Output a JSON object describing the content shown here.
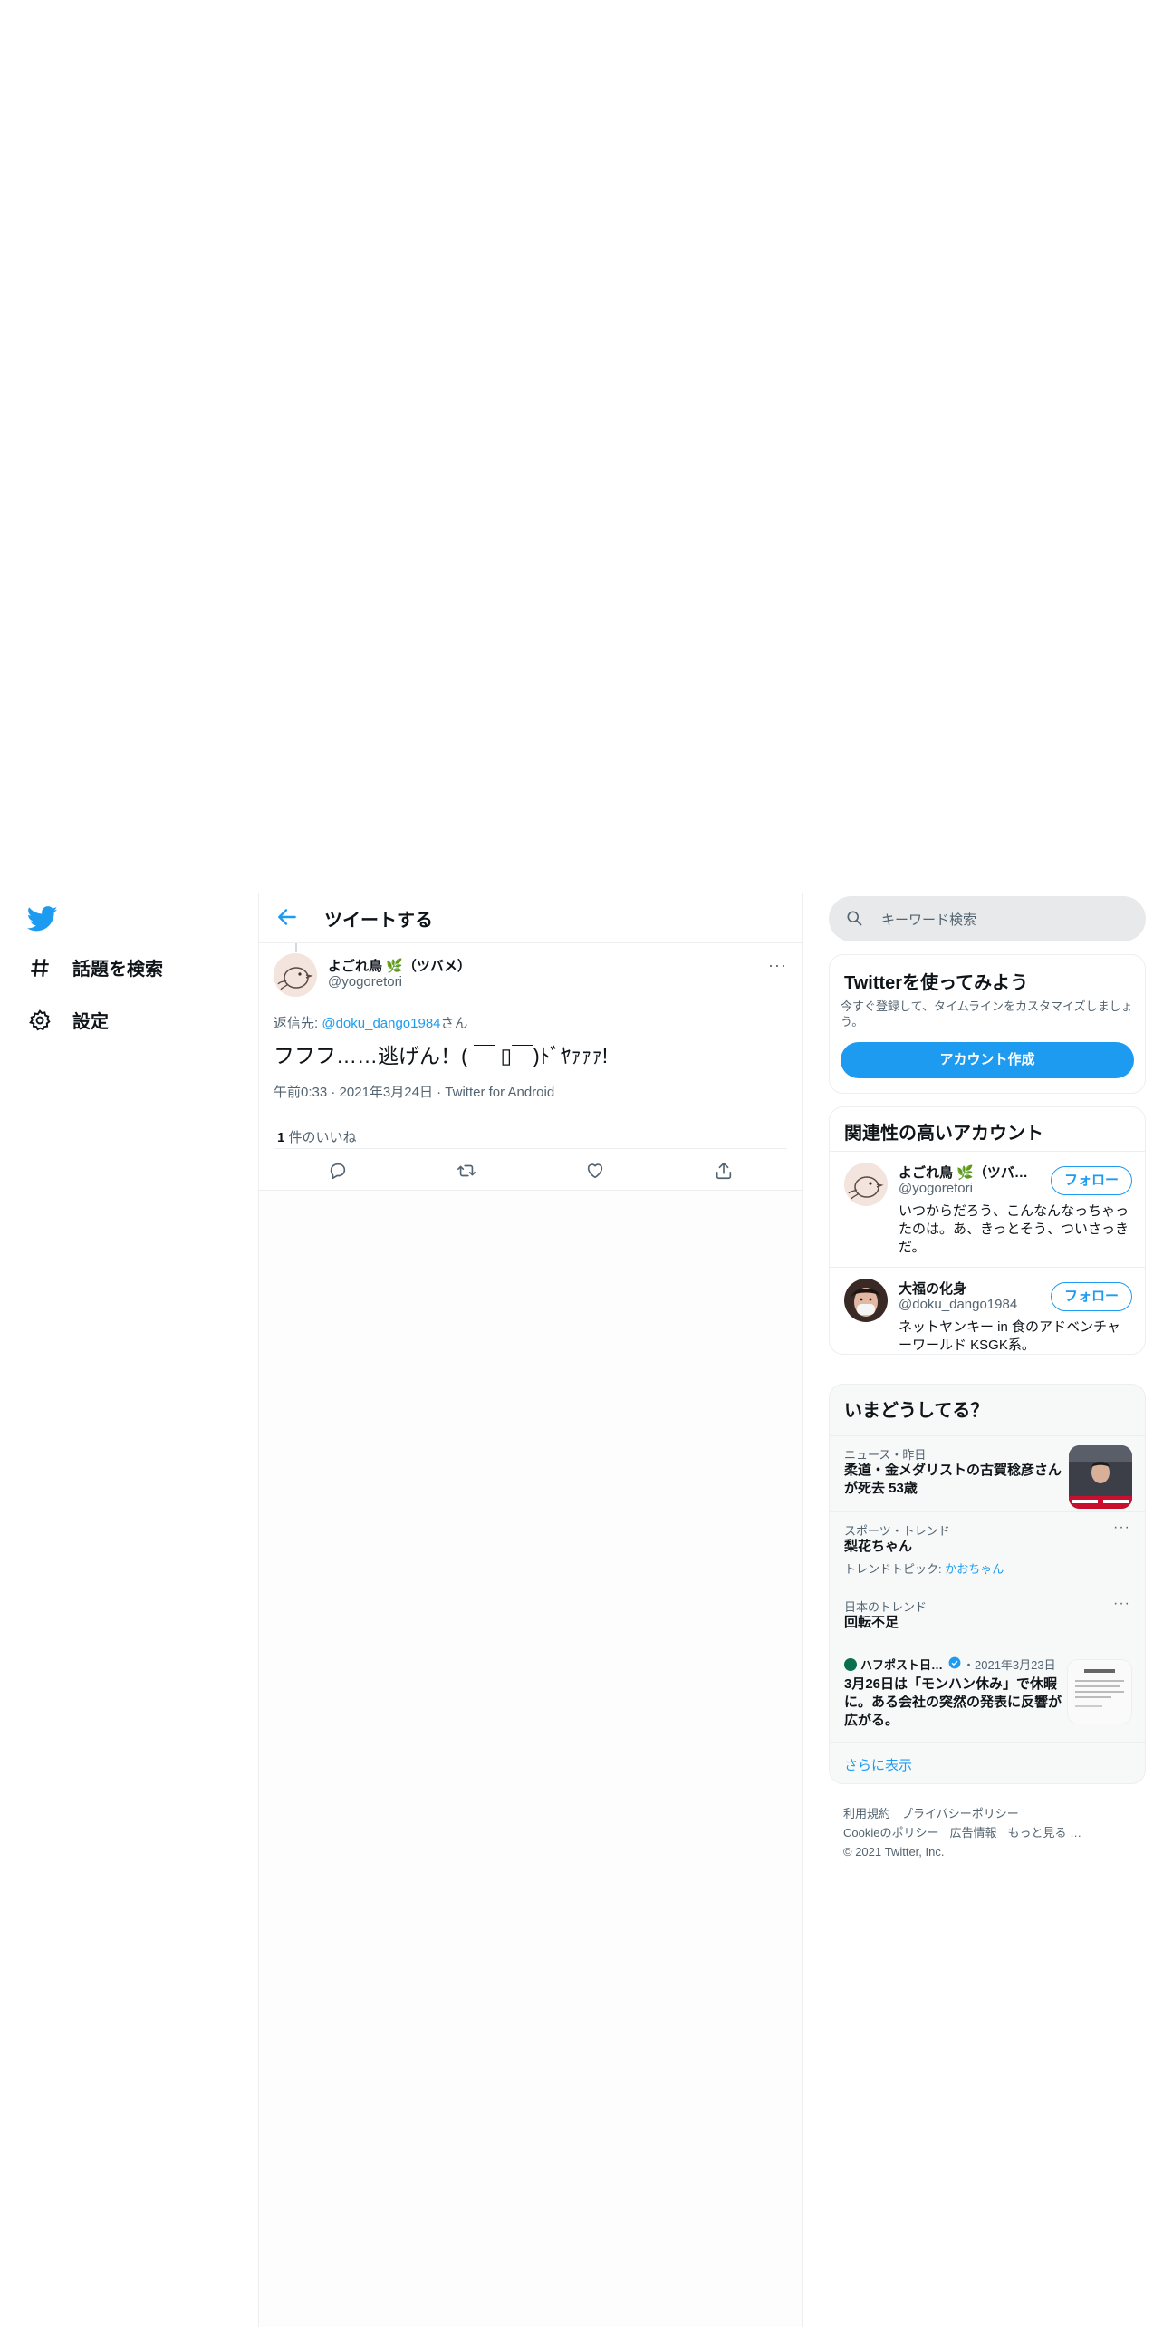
{
  "nav": {
    "explore_label": "話題を検索",
    "settings_label": "設定"
  },
  "header": {
    "title": "ツイートする"
  },
  "tweet": {
    "author_name": "よごれ鳥 🌿（ツバメ）",
    "author_handle": "@yogoretori",
    "reply_prefix": "返信先: ",
    "reply_target": "@doku_dango1984",
    "reply_suffix": "さん",
    "text": "フフフ……逃げん！( ￣ ▯￣)ﾄﾞﾔｧｧｧ!",
    "time": "午前0:33",
    "date": "2021年3月24日",
    "source": "Twitter for Android",
    "like_count": "1",
    "like_label": " 件のいいね"
  },
  "search": {
    "placeholder": "キーワード検索"
  },
  "signup": {
    "title": "Twitterを使ってみよう",
    "subtitle": "今すぐ登録して、タイムラインをカスタマイズしましょう。",
    "button": "アカウント作成"
  },
  "relevant": {
    "title": "関連性の高いアカウント",
    "accounts": [
      {
        "name": "よごれ鳥 🌿（ツバメ）",
        "handle": "@yogoretori",
        "bio": "いつからだろう、こんなんなっちゃったのは。あ、きっとそう、ついさっきだ。",
        "follow": "フォロー"
      },
      {
        "name": "大福の化身",
        "handle": "@doku_dango1984",
        "bio": "ネットヤンキー in 食のアドベンチャーワールド KSGK系。",
        "follow": "フォロー"
      }
    ]
  },
  "trends": {
    "title": "いまどうしてる？",
    "items": [
      {
        "context": "ニュース・昨日",
        "title": "柔道・金メダリストの古賀稔彦さんが死去 53歳"
      },
      {
        "context": "スポーツ・トレンド",
        "title": "梨花ちゃん",
        "sub_prefix": "トレンドトピック: ",
        "sub_link": "かおちゃん"
      },
      {
        "context": "日本のトレンド",
        "title": "回転不足"
      },
      {
        "source": "ハフポスト日…",
        "date": "・2021年3月23日",
        "title": "3月26日は「モンハン休み」で休暇に。ある会社の突然の発表に反響が広がる。"
      }
    ],
    "show_more": "さらに表示"
  },
  "footer": {
    "links": [
      "利用規約",
      "プライバシーポリシー",
      "Cookieのポリシー",
      "広告情報",
      "もっと見る …"
    ],
    "copyright": "© 2021 Twitter, Inc."
  },
  "colors": {
    "accent": "#1d9bf0",
    "secondary_text": "#536471",
    "border": "#eceef0"
  },
  "icons": [
    "twitter-logo-icon",
    "hashtag-icon",
    "gear-icon",
    "back-arrow-icon",
    "more-icon",
    "reply-icon",
    "retweet-icon",
    "like-icon",
    "share-icon",
    "search-icon",
    "verified-icon"
  ]
}
